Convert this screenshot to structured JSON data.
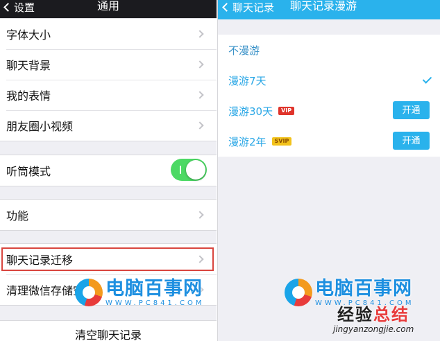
{
  "left": {
    "nav": {
      "back_label": "设置",
      "title": "通用"
    },
    "group1": [
      {
        "label": "字体大小"
      },
      {
        "label": "聊天背景"
      },
      {
        "label": "我的表情"
      },
      {
        "label": "朋友圈小视频"
      }
    ],
    "group2": {
      "label": "听筒模式",
      "toggle_on": true
    },
    "group3": {
      "label": "功能"
    },
    "group4": [
      {
        "label": "聊天记录迁移",
        "highlighted": true
      },
      {
        "label": "清理微信存储空间"
      }
    ],
    "clear_chat_label": "清空聊天记录"
  },
  "right": {
    "nav": {
      "back_label": "聊天记录",
      "title": "聊天记录漫游"
    },
    "options": [
      {
        "label": "不漫游"
      },
      {
        "label": "漫游7天",
        "selected": true
      },
      {
        "label": "漫游30天",
        "badge": "VIP",
        "button": "开通"
      },
      {
        "label": "漫游2年",
        "badge": "SVIP",
        "button": "开通"
      }
    ]
  },
  "watermarks": {
    "pc841": {
      "name": "电脑百事网",
      "url": "WWW.PC841.COM"
    },
    "jingyan": {
      "name_a": "经验",
      "name_b": "总结",
      "url": "jingyanzongjie.com"
    }
  },
  "colors": {
    "qq_blue": "#2ab2ec",
    "toggle_green": "#4cd964",
    "highlight_red": "#d9453e",
    "vip_red": "#e0342b",
    "svip_gold": "#f2c21b"
  }
}
